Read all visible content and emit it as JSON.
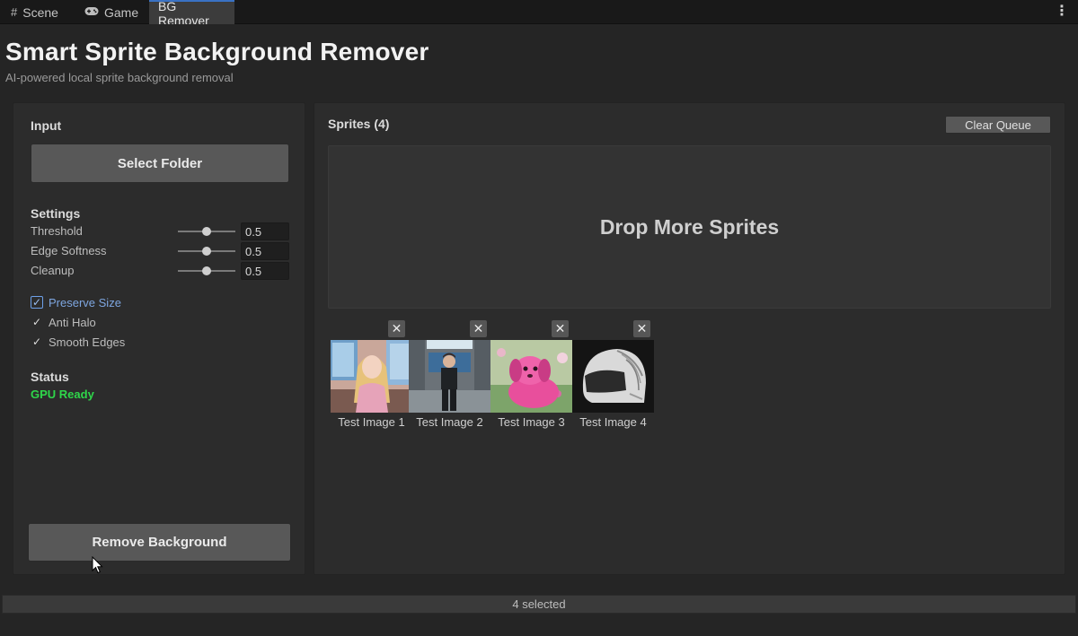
{
  "tabs": [
    {
      "label": "Scene",
      "icon": "grid-icon"
    },
    {
      "label": "Game",
      "icon": "gamepad-icon"
    },
    {
      "label": "BG Remover",
      "icon": ""
    }
  ],
  "header": {
    "title": "Smart Sprite Background Remover",
    "subtitle": "AI-powered local sprite background removal"
  },
  "input": {
    "label": "Input",
    "select_folder_label": "Select Folder"
  },
  "settings": {
    "label": "Settings",
    "sliders": [
      {
        "label": "Threshold",
        "value": "0.5",
        "fraction": 0.5
      },
      {
        "label": "Edge Softness",
        "value": "0.5",
        "fraction": 0.5
      },
      {
        "label": "Cleanup",
        "value": "0.5",
        "fraction": 0.5
      }
    ],
    "checkboxes": [
      {
        "label": "Preserve Size",
        "checked": true,
        "focused": true
      },
      {
        "label": "Anti Halo",
        "checked": true,
        "focused": false
      },
      {
        "label": "Smooth Edges",
        "checked": true,
        "focused": false
      }
    ]
  },
  "status": {
    "label": "Status",
    "value": "GPU Ready",
    "color": "#2fd64a"
  },
  "actions": {
    "remove_background_label": "Remove Background"
  },
  "sprites": {
    "header": "Sprites (4)",
    "clear_queue_label": "Clear Queue",
    "dropzone_text": "Drop More Sprites",
    "items": [
      {
        "name": "Test Image 1"
      },
      {
        "name": "Test Image 2"
      },
      {
        "name": "Test Image 3"
      },
      {
        "name": "Test Image 4"
      }
    ]
  },
  "footer": {
    "selection_text": "4 selected"
  },
  "colors": {
    "accent": "#3a72c4",
    "status_ok": "#2fd64a",
    "focus": "#7ea6e0"
  }
}
